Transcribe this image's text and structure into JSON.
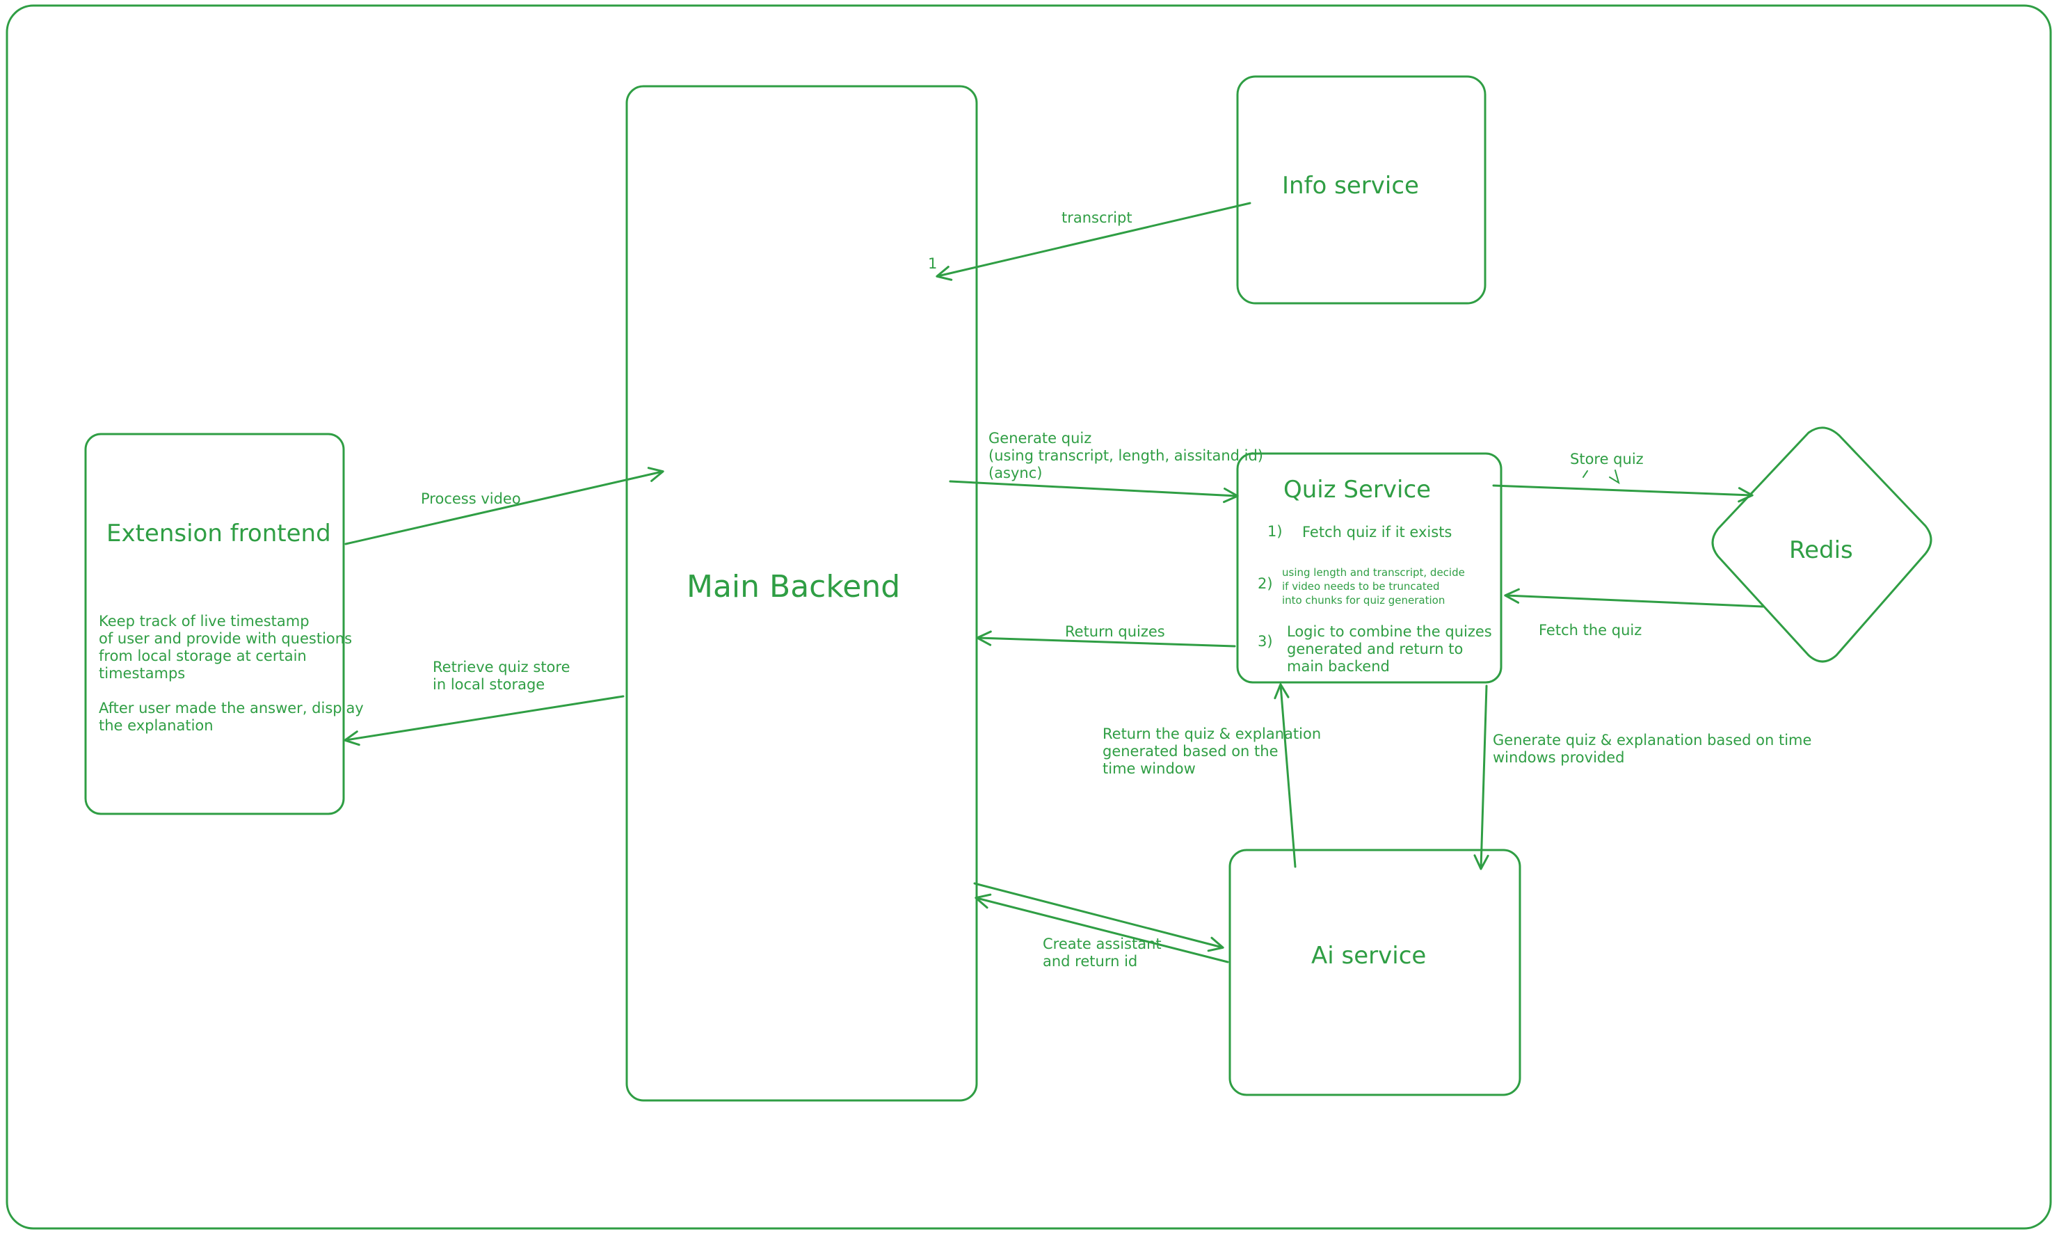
{
  "colors": {
    "stroke": "#2f9e44",
    "text": "#2f9e44",
    "background": "#ffffff"
  },
  "nodes": {
    "extension_frontend": {
      "title": "Extension frontend",
      "notes": [
        "Keep track of live timestamp",
        "of user and provide with questions",
        "from local storage at certain",
        "timestamps",
        "",
        "After user made the answer, display",
        "the explanation"
      ]
    },
    "main_backend": {
      "title": "Main Backend"
    },
    "info_service": {
      "title": "Info service"
    },
    "quiz_service": {
      "title": "Quiz Service",
      "steps": [
        {
          "num": "1)",
          "lines": [
            "Fetch quiz if it exists"
          ]
        },
        {
          "num": "2)",
          "lines": [
            "using length and transcript, decide",
            "if video needs to be truncated",
            "into chunks for quiz generation"
          ]
        },
        {
          "num": "3)",
          "lines": [
            "Logic to combine the quizes",
            "generated and return to",
            "main backend"
          ]
        }
      ]
    },
    "redis": {
      "title": "Redis"
    },
    "ai_service": {
      "title": "Ai service"
    }
  },
  "edges": {
    "process_video": {
      "label": [
        "Process video"
      ]
    },
    "retrieve_quiz": {
      "label": [
        "Retrieve quiz store",
        "in local storage"
      ]
    },
    "transcript": {
      "label": [
        "transcript"
      ],
      "marker": "1"
    },
    "generate_quiz": {
      "label": [
        "Generate quiz",
        "(using transcript, length, aissitand id)",
        "(async)"
      ]
    },
    "return_quizes": {
      "label": [
        "Return quizes"
      ]
    },
    "store_quiz": {
      "label": [
        "Store quiz"
      ]
    },
    "fetch_the_quiz": {
      "label": [
        "Fetch the quiz"
      ]
    },
    "return_quiz_explanation": {
      "label": [
        "Return the quiz & explanation",
        "generated based on the",
        "time window"
      ]
    },
    "generate_quiz_explanation": {
      "label": [
        "Generate quiz & explanation based on time",
        "windows provided"
      ]
    },
    "create_assistant": {
      "label": [
        "Create assistant",
        "and return id"
      ]
    }
  }
}
